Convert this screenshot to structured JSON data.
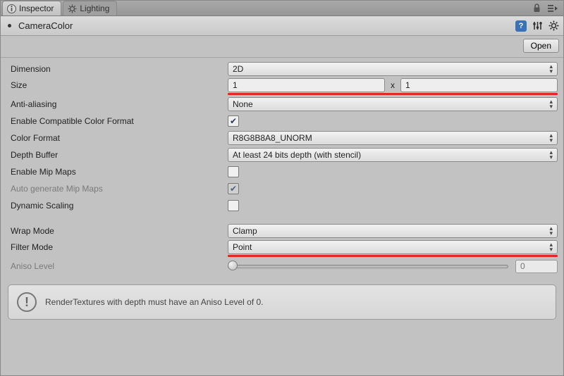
{
  "tabs": {
    "inspector": "Inspector",
    "lighting": "Lighting"
  },
  "asset": {
    "name": "CameraColor",
    "open_label": "Open"
  },
  "labels": {
    "dimension": "Dimension",
    "size": "Size",
    "size_x": "x",
    "anti_aliasing": "Anti-aliasing",
    "enable_compat": "Enable Compatible Color Format",
    "color_format": "Color Format",
    "depth_buffer": "Depth Buffer",
    "enable_mip": "Enable Mip Maps",
    "auto_mip": "Auto generate Mip Maps",
    "dynamic_scaling": "Dynamic Scaling",
    "wrap_mode": "Wrap Mode",
    "filter_mode": "Filter Mode",
    "aniso_level": "Aniso Level"
  },
  "values": {
    "dimension": "2D",
    "size_w": "1",
    "size_h": "1",
    "anti_aliasing": "None",
    "enable_compat": true,
    "color_format": "R8G8B8A8_UNORM",
    "depth_buffer": "At least 24 bits depth (with stencil)",
    "enable_mip": false,
    "auto_mip": true,
    "dynamic_scaling": false,
    "wrap_mode": "Clamp",
    "filter_mode": "Point",
    "aniso_level": "0"
  },
  "info": {
    "message": "RenderTextures with depth must have an Aniso Level of 0."
  }
}
